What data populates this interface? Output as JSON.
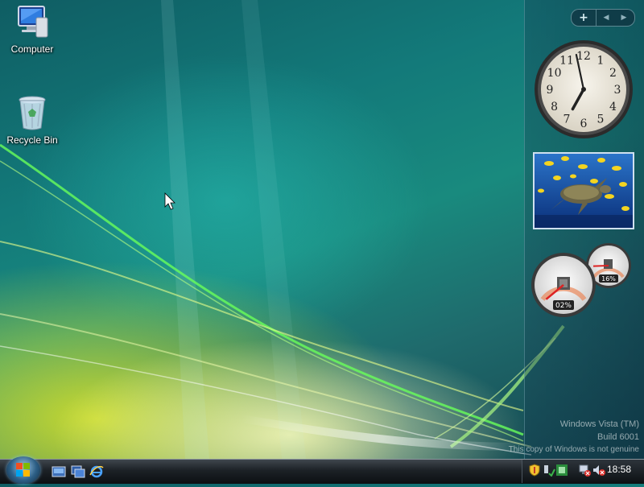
{
  "desktop": {
    "icons": [
      {
        "label": "Computer"
      },
      {
        "label": "Recycle Bin"
      }
    ]
  },
  "sidebar": {
    "controls": {
      "add": "+",
      "prev": "◀",
      "next": "▶"
    },
    "clock": {
      "hour": 6,
      "minute": 58,
      "numerals": [
        "12",
        "1",
        "2",
        "3",
        "4",
        "5",
        "6",
        "7",
        "8",
        "9",
        "10",
        "11"
      ]
    },
    "cpu_meter": {
      "cpu_label": "02%",
      "memory_label": "16%",
      "cpu_value": 0.02,
      "memory_value": 0.16
    }
  },
  "watermark": {
    "line1": "Windows Vista (TM)",
    "line2": "Build 6001",
    "line3": "This copy of Windows is not genuine"
  },
  "taskbar": {
    "start_button": "start-orb",
    "quick_launch": [
      "show-desktop-icon",
      "switch-windows-icon",
      "internet-explorer-icon"
    ],
    "tray_icons": [
      "security-shield-icon",
      "network-status-icon",
      "antivirus-icon",
      "network-disconnected-icon",
      "volume-muted-icon"
    ],
    "clock": "18:58"
  },
  "colors": {
    "accent": "#1a8a80",
    "taskbar": "#1c2126"
  }
}
